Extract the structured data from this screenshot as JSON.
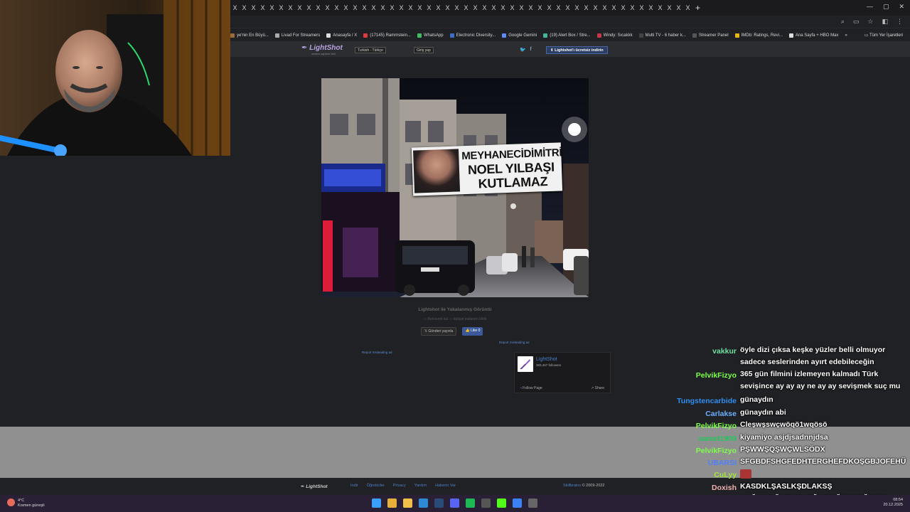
{
  "browser": {
    "tab_close_glyph": "X",
    "tab_count": 50,
    "bookmarks": [
      {
        "label": "ye'nin En Büyü...",
        "color": "#9a6b3a"
      },
      {
        "label": "Livad For Streamers",
        "color": "#aaaaaa"
      },
      {
        "label": "Anasayfa / X",
        "color": "#dddddd"
      },
      {
        "label": "(17145) Rammstein...",
        "color": "#e03a3a"
      },
      {
        "label": "WhatsApp",
        "color": "#3fbf5f"
      },
      {
        "label": "Electronic Diversity...",
        "color": "#3a6ec9"
      },
      {
        "label": "Google Gemini",
        "color": "#5c8df0"
      },
      {
        "label": "(19) Alert Box / Stre...",
        "color": "#46b39b"
      },
      {
        "label": "Windy: Sıcaklık",
        "color": "#c8364a"
      },
      {
        "label": "Multi TV - 6 haber k...",
        "color": "#444444"
      },
      {
        "label": "Streamer Panel",
        "color": "#555555"
      },
      {
        "label": "IMDb: Ratings, Revi...",
        "color": "#e5b513"
      },
      {
        "label": "Ana Sayfa + HBO Max",
        "color": "#dddddd"
      }
    ],
    "bookmarks_all": "Tüm Yer İşaretleri",
    "overflow": "»"
  },
  "lightshot": {
    "logo": "LightShot",
    "tagline": "screen capture tool",
    "language": "Turkish - Türkçe",
    "login": "Giriş yap",
    "social": [
      "🐦",
      "f"
    ],
    "download": "Lightshot'ı ücretsiz indirin",
    "banner": {
      "line1": "MEYHANECİDİMİTRİ",
      "line2": "NOEL YILBAŞI",
      "line3": "KUTLAMAZ"
    },
    "caption_title": "Lightshot ile Yakalanmış Görüntü",
    "caption_sub": "▭ Benzerini bul   ▭ kütüye kullanım bildir",
    "tweet": "Gönderi yayınla",
    "like": "👍 Like 0",
    "report_left": "Report misleading ad",
    "report_right": "Report misleading ad",
    "fb": {
      "name": "LightShot",
      "followers": "383,467 followers",
      "follow": "Follow Page",
      "share": "Share"
    },
    "footer_logo": "LightShot",
    "footer_links": [
      "İndir",
      "Öğreticiler",
      "Privacy",
      "Yardım",
      "Haberin Var"
    ],
    "footer_copy_link": "Skillbrains",
    "footer_copy_text": " © 2009-2022"
  },
  "chat": [
    {
      "user": "vakkur",
      "color": "#6fe0a0",
      "msg": "öyle dizi çıksa keşke yüzler belli olmuyor sadece seslerinden ayırt edebileceğin"
    },
    {
      "user": "PelvikFizyo",
      "color": "#7dff4a",
      "msg": "365 gün filmini izlemeyen kalmadı Türk sevişince ay ay ay ne ay ay sevişmek suç mu"
    },
    {
      "user": "Tungstencarbide",
      "color": "#2e8ff0",
      "msg": "günaydın"
    },
    {
      "user": "Carlakse",
      "color": "#6ab0ff",
      "msg": "günaydın abi"
    },
    {
      "user": "PelvikFizyo",
      "color": "#7dff4a",
      "msg": "Cleşwşswçwöqö1wqösö"
    },
    {
      "user": "samet1909",
      "color": "#22c55e",
      "msg": "kiyamiyo asjdjsadnnjdsa"
    },
    {
      "user": "PelvikFizyo",
      "color": "#7dff4a",
      "msg": "PŞWWŞQŞWÇWLSÖDX"
    },
    {
      "user": "UBARSI",
      "color": "#4f7fff",
      "msg": "SFGBDFSHGFEDHTERGHEFDKOŞGBJOFEHÜ"
    },
    {
      "user": "CuLyy",
      "color": "#a3e635",
      "msg": ""
    },
    {
      "user": "Doxish",
      "color": "#f0b0b0",
      "msg": "KASDKLŞASLKŞDLAKSŞ"
    },
    {
      "user": "Doxish",
      "color": "#f0b0b0",
      "msg": "QPĞWKPĞLQWDLPĞWDPĞLWDPĞDWQ"
    }
  ],
  "taskbar": {
    "temp": "4°C",
    "weather": "Kısmen güneşli",
    "time": "08:54",
    "date": "20.12.2025",
    "icons": [
      {
        "name": "windows-start-icon",
        "color": "#3aa0ff"
      },
      {
        "name": "chrome-icon",
        "color": "#e8b23a"
      },
      {
        "name": "file-explorer-icon",
        "color": "#f0c04a"
      },
      {
        "name": "edge-icon",
        "color": "#2f8ad6"
      },
      {
        "name": "steam-icon",
        "color": "#2a4b78"
      },
      {
        "name": "discord-icon",
        "color": "#5865f2"
      },
      {
        "name": "spotify-icon",
        "color": "#1db954"
      },
      {
        "name": "calculator-icon",
        "color": "#555555"
      },
      {
        "name": "kick-icon",
        "color": "#53fc18"
      },
      {
        "name": "app-icon",
        "color": "#3b82f6"
      },
      {
        "name": "obs-icon",
        "color": "#666666"
      }
    ]
  }
}
